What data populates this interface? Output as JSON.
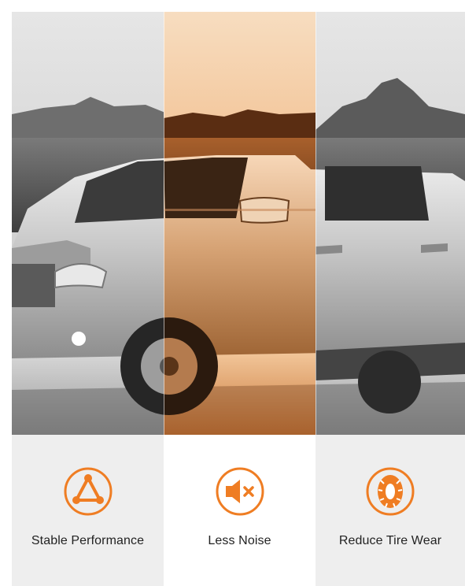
{
  "features": [
    {
      "label": "Stable Performance",
      "icon": "triangle-nodes-icon"
    },
    {
      "label": "Less Noise",
      "icon": "speaker-mute-icon"
    },
    {
      "label": "Reduce Tire Wear",
      "icon": "tire-icon"
    }
  ],
  "colors": {
    "accent": "#ef7d23",
    "label": "#222222",
    "panel_light": "#eeeeee",
    "panel_white": "#ffffff"
  },
  "hero": {
    "image_subject": "silver pickup truck on desert road",
    "center_tint": "orange sunset"
  }
}
